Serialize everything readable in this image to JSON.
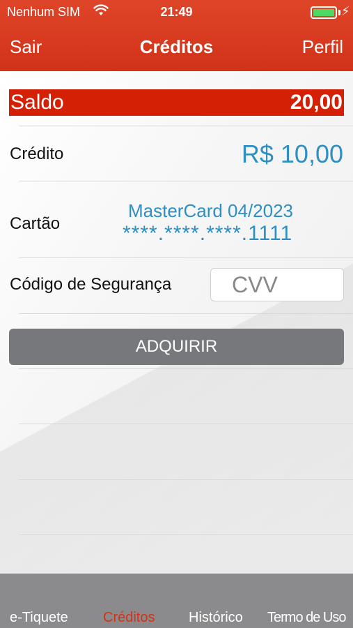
{
  "status_bar": {
    "carrier": "Nenhum SIM",
    "time": "21:49",
    "wifi_icon": "wifi-icon",
    "battery_icon": "battery-icon",
    "battery_level": 1.0,
    "charging_glyph": "⚡"
  },
  "nav": {
    "left_label": "Sair",
    "title": "Créditos",
    "right_label": "Perfil"
  },
  "saldo": {
    "label": "Saldo",
    "value": "20,00"
  },
  "credito": {
    "label": "Crédito",
    "value": "R$ 10,00"
  },
  "cartao": {
    "label": "Cartão",
    "brand_expiry": "MasterCard 04/2023",
    "masked_number": "****.****.****.1111"
  },
  "seguranca": {
    "label": "Código de Segurança",
    "placeholder": "CVV",
    "value": ""
  },
  "actions": {
    "buy_label": "ADQUIRIR"
  },
  "tabs": [
    {
      "label": "e-Tiquete",
      "active": false
    },
    {
      "label": "Créditos",
      "active": true
    },
    {
      "label": "Histórico",
      "active": false
    },
    {
      "label": "Termo de Uso",
      "active": false
    }
  ],
  "colors": {
    "header": "#d13219",
    "saldo_bar": "#d42106",
    "accent_blue": "#2f8ec2",
    "button_gray": "#77787c",
    "tabbar": "#8b8b8d",
    "active_tab": "#d13219",
    "battery_green": "#4cd964"
  }
}
